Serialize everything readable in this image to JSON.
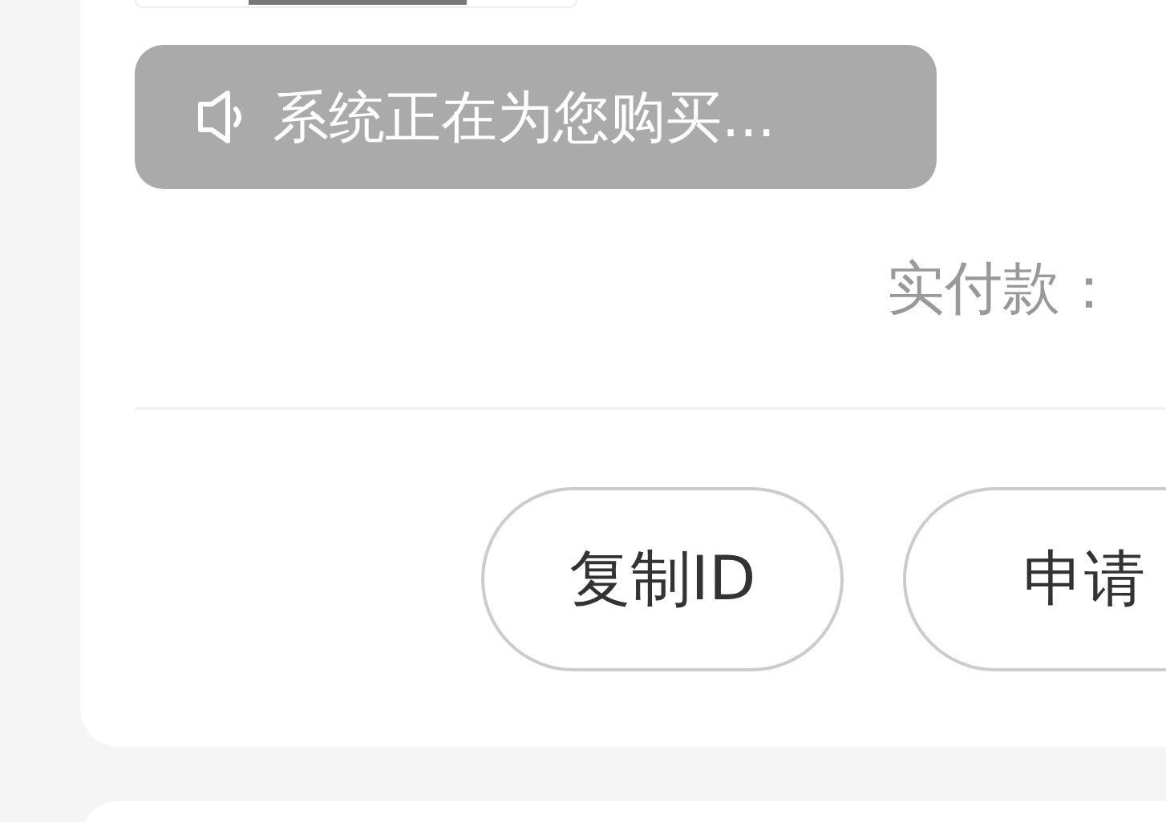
{
  "notice": {
    "text": "系统正在为您购买..."
  },
  "payment": {
    "label": "实付款："
  },
  "buttons": [
    {
      "label": "复制ID"
    },
    {
      "label": "申请"
    }
  ]
}
